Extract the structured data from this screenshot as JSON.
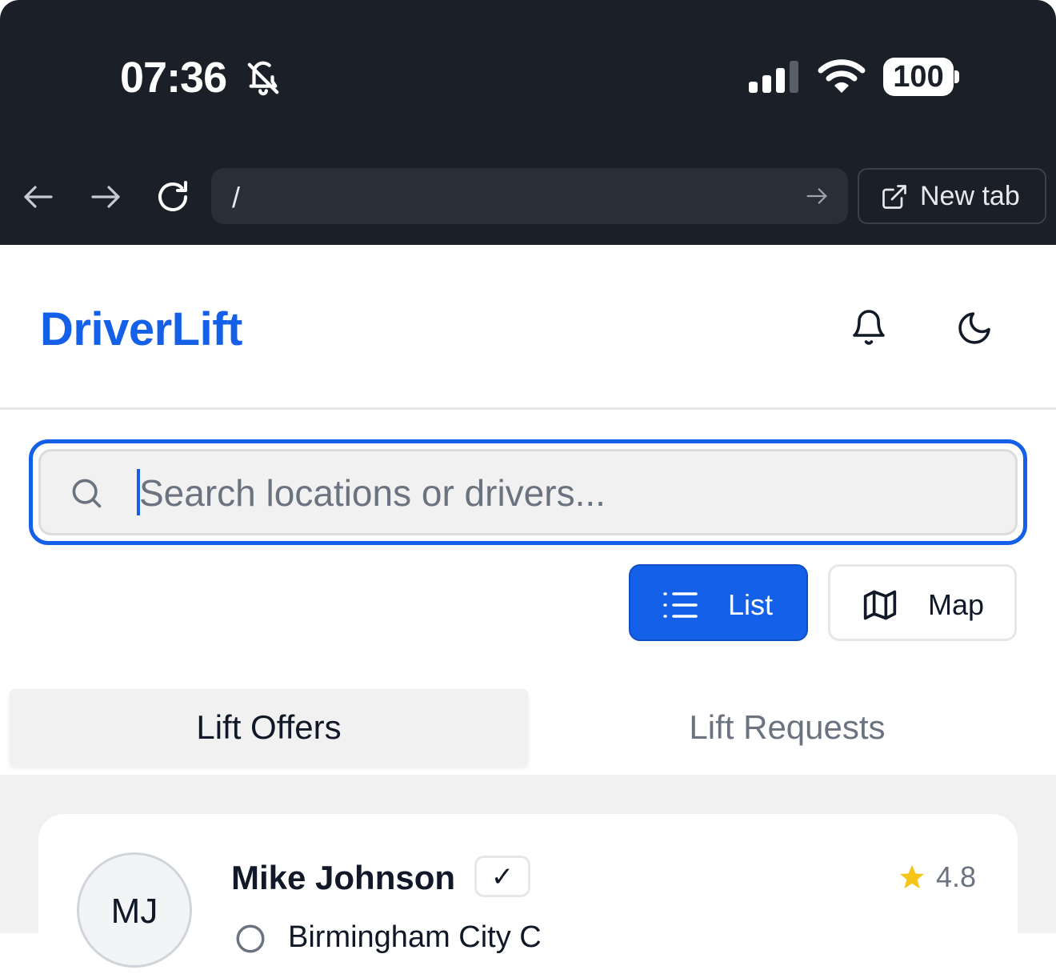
{
  "status_bar": {
    "time": "07:36",
    "battery": "100"
  },
  "browser": {
    "url": "/",
    "new_tab_label": "New tab"
  },
  "header": {
    "brand": "DriverLift"
  },
  "search": {
    "placeholder": "Search locations or drivers..."
  },
  "view_toggle": {
    "list_label": "List",
    "map_label": "Map",
    "active": "List"
  },
  "tabs": [
    {
      "label": "Lift Offers",
      "active": true
    },
    {
      "label": "Lift Requests",
      "active": false
    }
  ],
  "listings": [
    {
      "initials": "MJ",
      "driver_name": "Mike Johnson",
      "verified": "✓",
      "rating": "4.8",
      "location": "Birmingham City C"
    }
  ],
  "colors": {
    "brand": "#1560e8",
    "chrome_bg": "#1b1f27",
    "star": "#f5c518"
  }
}
